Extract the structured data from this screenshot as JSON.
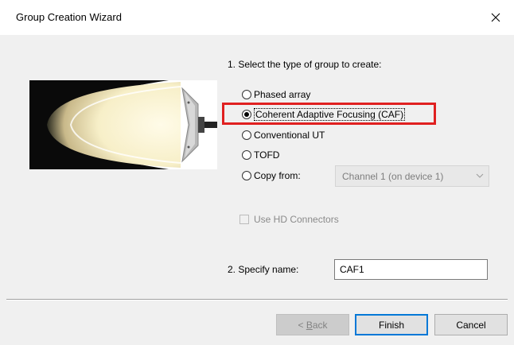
{
  "window": {
    "title": "Group Creation Wizard",
    "close_icon": "close-icon"
  },
  "step1": {
    "label": "1. Select the type of group to create:",
    "options": [
      {
        "label": "Phased array",
        "selected": false
      },
      {
        "label": "Coherent Adaptive Focusing (CAF)",
        "selected": true
      },
      {
        "label": "Conventional UT",
        "selected": false
      },
      {
        "label": "TOFD",
        "selected": false
      },
      {
        "label": "Copy from:",
        "selected": false
      }
    ],
    "copy_from_value": "Channel 1 (on device 1)",
    "use_hd_connectors": {
      "label": "Use HD Connectors",
      "checked": false,
      "enabled": false
    }
  },
  "step2": {
    "label": "2. Specify name:",
    "name_value": "CAF1"
  },
  "buttons": {
    "back_prefix": "< ",
    "back_mnemonic": "B",
    "back_rest": "ack",
    "finish": "Finish",
    "cancel": "Cancel"
  },
  "colors": {
    "highlight": "#e02020",
    "default_button_border": "#0078d7"
  }
}
